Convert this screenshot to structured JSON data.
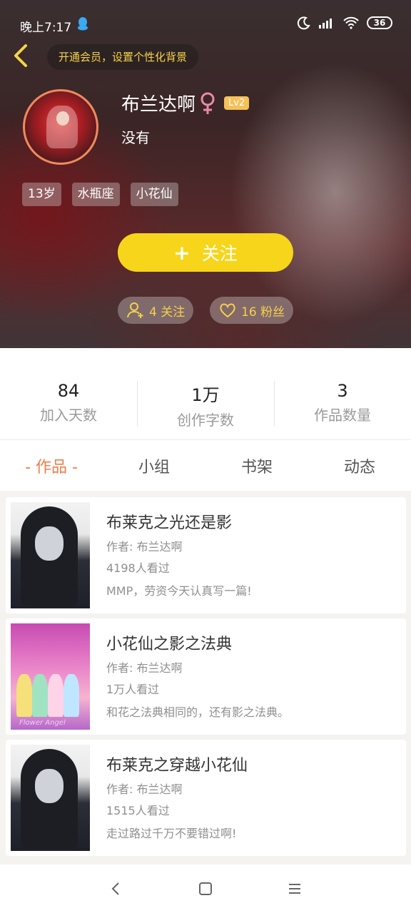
{
  "status": {
    "time": "晚上7:17",
    "battery": "36"
  },
  "header": {
    "vip_text": "开通会员，设置个性化背景"
  },
  "profile": {
    "name": "布兰达啊",
    "gender_symbol": "♀",
    "level": "Lv2",
    "bio": "没有",
    "tags": [
      "13岁",
      "水瓶座",
      "小花仙"
    ]
  },
  "actions": {
    "follow_plus": "+",
    "follow_label": "关注"
  },
  "social": {
    "following": "4 关注",
    "fans": "16 粉丝"
  },
  "counters": [
    {
      "value": "84",
      "label": "加入天数"
    },
    {
      "value": "1万",
      "label": "创作字数"
    },
    {
      "value": "3",
      "label": "作品数量"
    }
  ],
  "tabs": [
    "- 作品 -",
    "小组",
    "书架",
    "动态"
  ],
  "works": [
    {
      "title": "布莱克之光还是影",
      "author": "作者: 布兰达啊",
      "views": "4198人看过",
      "desc": "MMP，劳资今天认真写一篇!"
    },
    {
      "title": "小花仙之影之法典",
      "author": "作者: 布兰达啊",
      "views": "1万人看过",
      "desc": "和花之法典相同的，还有影之法典。",
      "cover_caption": "Flower Angel"
    },
    {
      "title": "布莱克之穿越小花仙",
      "author": "作者: 布兰达啊",
      "views": "1515人看过",
      "desc": "走过路过千万不要错过啊!"
    }
  ],
  "colors": {
    "accent": "#f07c4a",
    "follow": "#f7d51b",
    "gold": "#f6d04c"
  }
}
